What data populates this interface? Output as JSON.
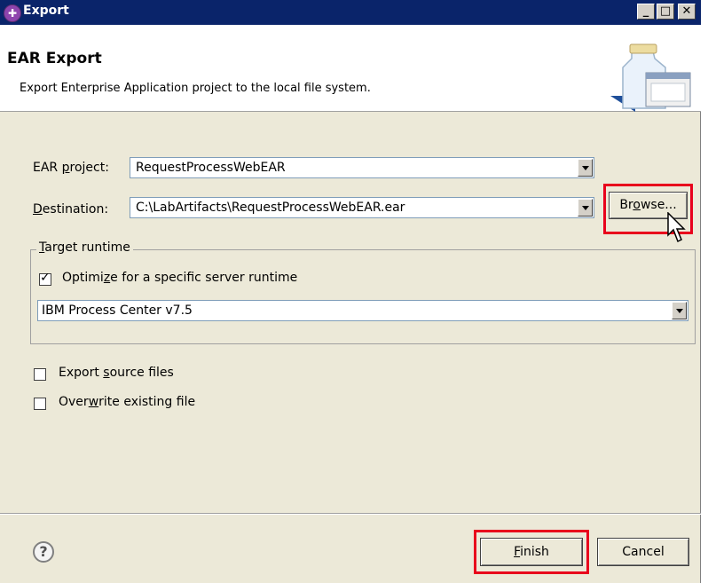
{
  "window": {
    "title": "Export"
  },
  "header": {
    "title": "EAR Export",
    "description": "Export Enterprise Application project to the local file system."
  },
  "form": {
    "ear_project_label_pre": "EAR ",
    "ear_project_label_mn": "p",
    "ear_project_label_post": "roject:",
    "ear_project_value": "RequestProcessWebEAR",
    "destination_label_mn": "D",
    "destination_label_post": "estination:",
    "destination_value": "C:\\LabArtifacts\\RequestProcessWebEAR.ear",
    "browse_pre": "Br",
    "browse_mn": "o",
    "browse_post": "wse..."
  },
  "target_runtime": {
    "title_mn": "T",
    "title_post": "arget runtime",
    "optimize_pre": "Optimi",
    "optimize_mn": "z",
    "optimize_post": "e for a specific server runtime",
    "optimize_checked": true,
    "runtime_value": "IBM Process Center v7.5"
  },
  "options": {
    "export_source_pre": "Export ",
    "export_source_mn": "s",
    "export_source_post": "ource files",
    "overwrite_pre": "Over",
    "overwrite_mn": "w",
    "overwrite_post": "rite existing file"
  },
  "footer": {
    "finish_mn": "F",
    "finish_post": "inish",
    "cancel": "Cancel"
  },
  "colors": {
    "highlight": "#e8001c",
    "titlebar": "#0a246a"
  }
}
